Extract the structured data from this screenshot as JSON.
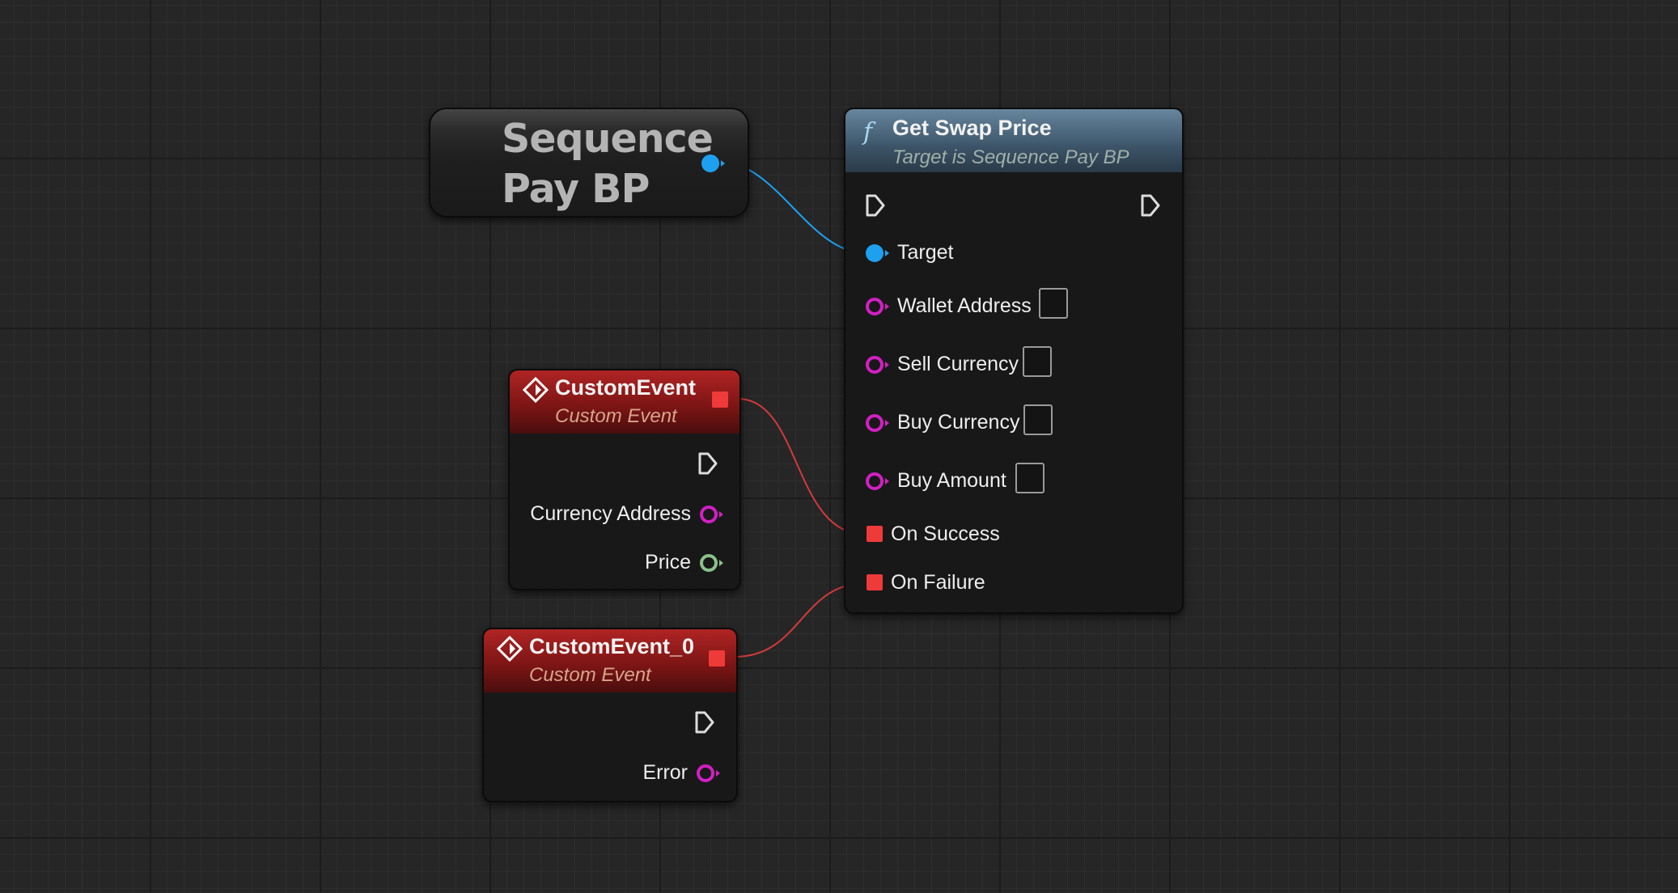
{
  "ref_node": {
    "title": "Sequence Pay BP"
  },
  "function_node": {
    "title": "Get Swap Price",
    "subtitle": "Target is Sequence Pay BP",
    "pins": {
      "target": "Target",
      "wallet_address": "Wallet Address",
      "sell_currency": "Sell Currency",
      "buy_currency": "Buy Currency",
      "buy_amount": "Buy Amount",
      "on_success": "On Success",
      "on_failure": "On Failure"
    }
  },
  "event_node_1": {
    "title": "CustomEvent",
    "subtitle": "Custom Event",
    "pins": {
      "currency_address": "Currency Address",
      "price": "Price"
    }
  },
  "event_node_2": {
    "title": "CustomEvent_0",
    "subtitle": "Custom Event",
    "pins": {
      "error": "Error"
    }
  },
  "colors": {
    "object_pin": "#1ea0f0",
    "string_pin": "#d21fc4",
    "float_pin": "#8ac28a",
    "delegate_pin": "#ef3a3a",
    "exec_pin": "#dcdcdc"
  }
}
